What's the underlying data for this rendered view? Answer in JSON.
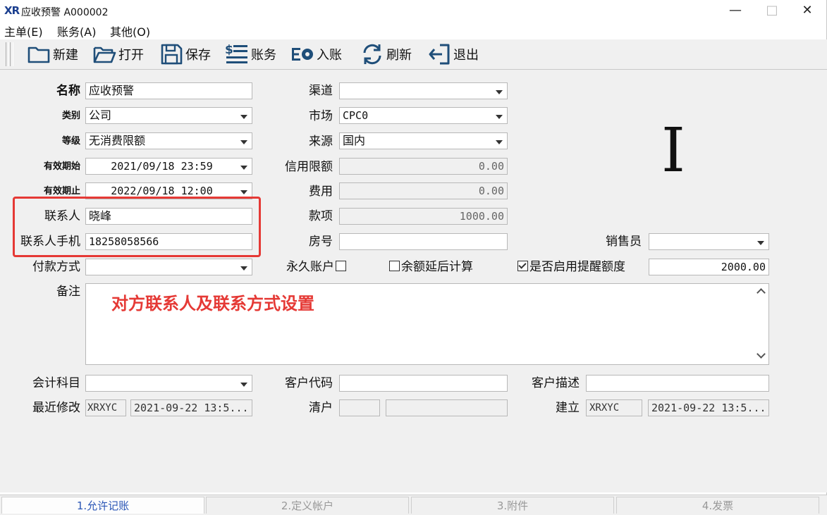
{
  "window": {
    "logo": "XR",
    "title": "应收预警  A000002",
    "min": "—",
    "max": "□",
    "close": "✕"
  },
  "menu": [
    "主单(E)",
    "账务(A)",
    "其他(O)"
  ],
  "toolbar": {
    "new": "新建",
    "open": "打开",
    "save": "保存",
    "account": "账务",
    "post": "入账",
    "refresh": "刷新",
    "exit": "退出"
  },
  "form": {
    "name_label": "名称",
    "name_value": "应收预警",
    "category_label": "类别",
    "category_value": "公司",
    "level_label": "等级",
    "level_value": "无消费限额",
    "valid_start_label": "有效期始",
    "valid_start_value": "2021/09/18 23:59",
    "valid_end_label": "有效期止",
    "valid_end_value": "2022/09/18 12:00",
    "contact_label": "联系人",
    "contact_value": "晓峰",
    "contact_phone_label": "联系人手机",
    "contact_phone_value": "18258058566",
    "payment_label": "付款方式",
    "payment_value": "",
    "channel_label": "渠道",
    "channel_value": "",
    "market_label": "市场",
    "market_value": "CPC0",
    "source_label": "来源",
    "source_value": "国内",
    "credit_label": "信用限额",
    "credit_value": "0.00",
    "fee_label": "费用",
    "fee_value": "0.00",
    "amount_label": "款项",
    "amount_value": "1000.00",
    "room_label": "房号",
    "room_value": "",
    "salesperson_label": "销售员",
    "salesperson_value": "",
    "permanent_label": "永久账户",
    "balance_delay_label": "余额延后计算",
    "reminder_label": "是否启用提醒额度",
    "reminder_value": "2000.00",
    "notes_label": "备注",
    "notes_value": "",
    "subject_label": "会计科目",
    "subject_value": "",
    "customer_code_label": "客户代码",
    "customer_code_value": "",
    "customer_desc_label": "客户描述",
    "customer_desc_value": "",
    "last_modified_label": "最近修改",
    "last_modified_user": "XRXYC",
    "last_modified_time": "2021-09-22 13:5...",
    "clear_label": "清户",
    "clear_value1": "",
    "clear_value2": "",
    "created_label": "建立",
    "created_user": "XRXYC",
    "created_time": "2021-09-22 13:5..."
  },
  "annotation": {
    "text": "对方联系人及联系方式设置",
    "color": "#e53935"
  },
  "tabs": [
    "1.允许记账",
    "2.定义帐户",
    "3.附件",
    "4.发票"
  ]
}
